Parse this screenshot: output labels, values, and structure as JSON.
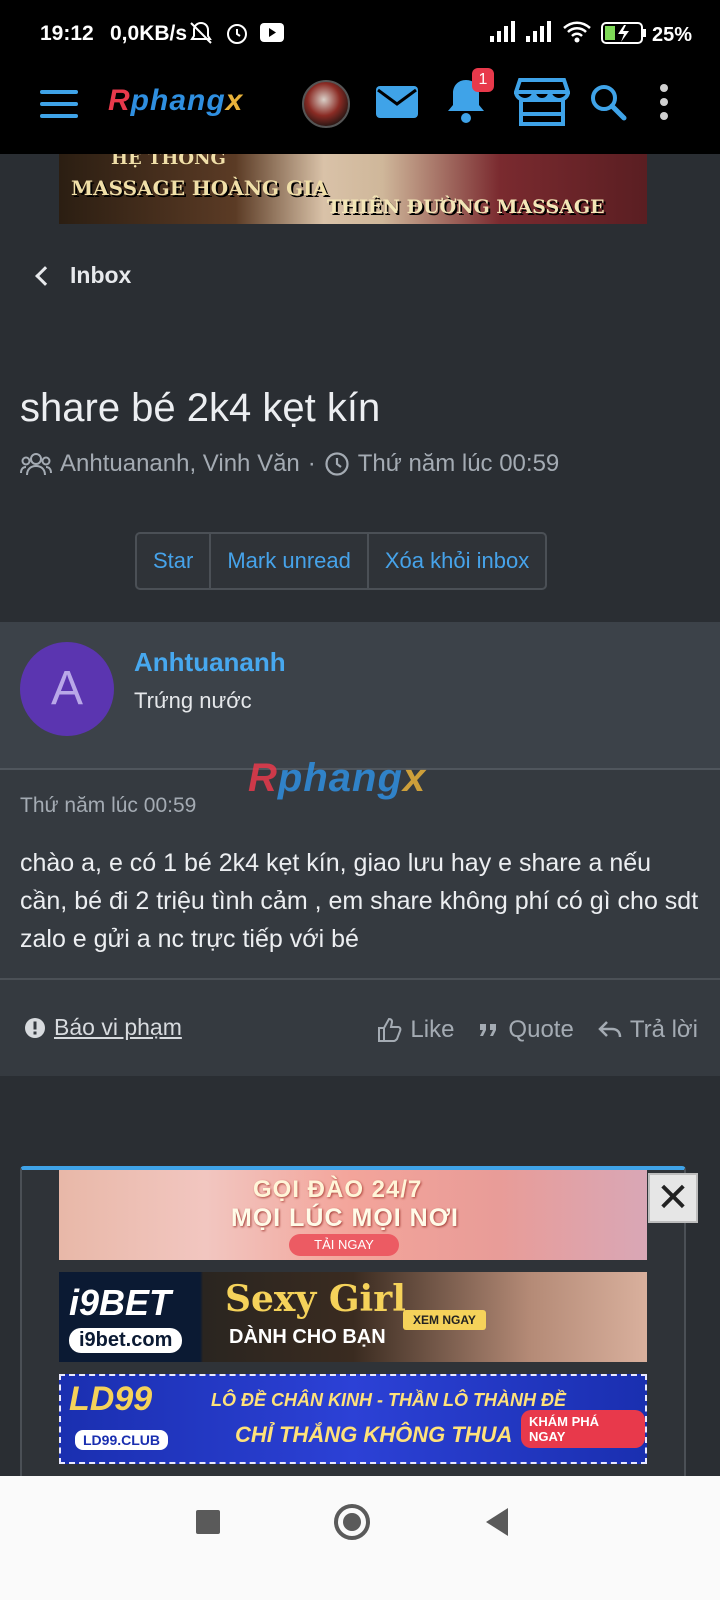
{
  "status_bar": {
    "time": "19:12",
    "net_speed": "0,0KB/s",
    "battery": "25%"
  },
  "nav": {
    "logo": {
      "r": "R",
      "main": "phang",
      "x": "x"
    },
    "notification_count": "1",
    "accent": "#3fa3e8"
  },
  "banners": {
    "top": {
      "line0": "HỆ THỐNG",
      "line1": "MASSAGE HOÀNG GIA",
      "line2": "THIÊN ĐƯỜNG MASSAGE"
    },
    "ad1": {
      "line1": "GỌI ĐÀO 24/7",
      "line2": "MỌI LÚC MỌI NƠI",
      "cta": "TẢI NGAY"
    },
    "ad2": {
      "brand": "i9BET",
      "site": "i9bet.com",
      "headline": "Sexy Girl",
      "sub": "DÀNH CHO BẠN",
      "cta": "XEM NGAY"
    },
    "ad3": {
      "brand": "LD99",
      "site": "LD99.CLUB",
      "line1": "LÔ ĐỀ CHÂN KINH - THẦN LÔ THÀNH ĐỀ",
      "line2": "CHỈ THẮNG KHÔNG THUA",
      "cta": "KHÁM PHÁ NGAY"
    }
  },
  "breadcrumb": {
    "label": "Inbox"
  },
  "conversation": {
    "title": "share bé 2k4 kẹt kín",
    "participants": "Anhtuananh, Vinh Văn",
    "separator": "·",
    "time": "Thứ năm lúc 00:59"
  },
  "buttons": {
    "star": "Star",
    "mark_unread": "Mark unread",
    "remove": "Xóa khỏi inbox"
  },
  "message": {
    "avatar_letter": "A",
    "username": "Anhtuananh",
    "user_title": "Trứng nước",
    "watermark": {
      "r": "R",
      "main": "phang",
      "x": "x"
    },
    "date": "Thứ năm lúc 00:59",
    "body": "chào a, e có 1 bé 2k4 kẹt kín, giao lưu hay e share a nếu cần, bé đi 2 triệu tình cảm , em share không phí có gì cho sdt zalo e gửi a nc trực tiếp với bé",
    "report": "Báo vi phạm",
    "like": "Like",
    "quote": "Quote",
    "reply": "Trả lời"
  },
  "close_label": "✕"
}
